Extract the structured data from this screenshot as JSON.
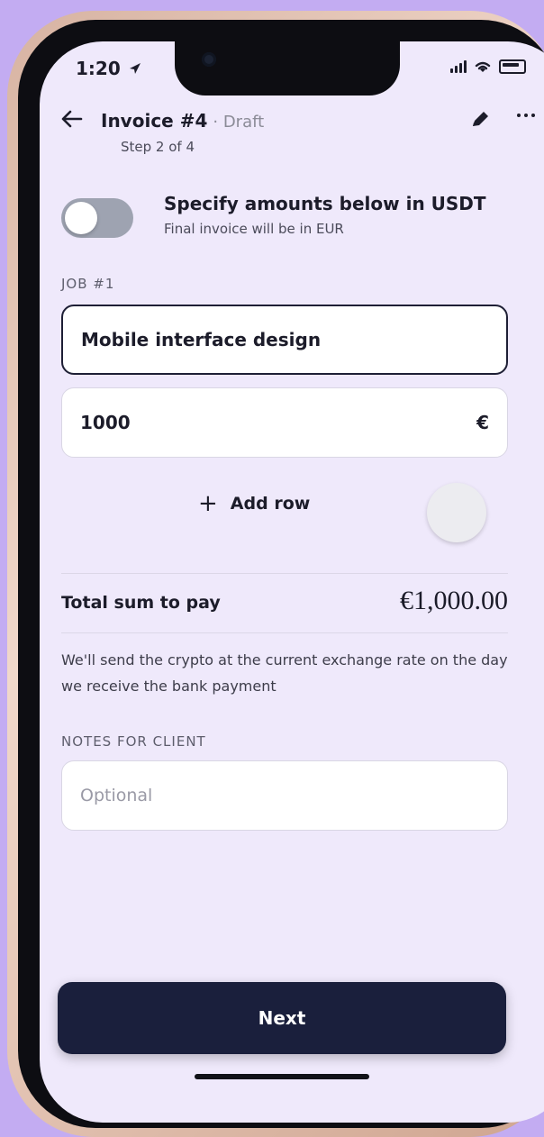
{
  "status_bar": {
    "time": "1:20"
  },
  "header": {
    "title": "Invoice #4",
    "status": "· Draft",
    "step": "Step 2 of 4"
  },
  "toggle": {
    "title": "Specify amounts below in USDT",
    "subtitle": "Final invoice will be in EUR",
    "checked": false
  },
  "job": {
    "label": "JOB #1",
    "name": "Mobile interface design",
    "amount": "1000",
    "currency": "€"
  },
  "actions": {
    "add_row": "Add row",
    "next": "Next"
  },
  "summary": {
    "total_label": "Total sum to pay",
    "total_value": "€1,000.00",
    "explanation": "We'll send the crypto at the current exchange rate on the day we receive the bank payment"
  },
  "notes": {
    "label": "NOTES FOR CLIENT",
    "placeholder": "Optional"
  }
}
